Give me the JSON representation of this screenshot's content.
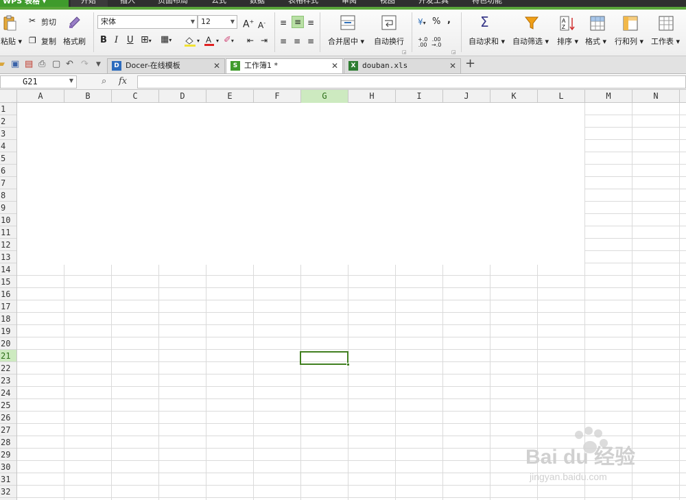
{
  "app": {
    "name": "WPS 表格"
  },
  "menu": [
    "开始",
    "插入",
    "页面布局",
    "公式",
    "数据",
    "表格样式",
    "审阅",
    "视图",
    "开发工具",
    "特色功能"
  ],
  "ribbon": {
    "paste": "粘贴",
    "cut": "剪切",
    "copy": "复制",
    "format_painter": "格式刷",
    "font_name": "宋体",
    "font_size": "12",
    "bold": "B",
    "italic": "I",
    "underline": "U",
    "merge_center": "合并居中",
    "wrap_text": "自动换行",
    "percent": "%",
    "comma": ",",
    "autosum": "自动求和",
    "autofilter": "自动筛选",
    "sort": "排序",
    "format": "格式",
    "rows_cols": "行和列",
    "worksheet": "工作表"
  },
  "tabs": [
    {
      "label": "Docer-在线模板",
      "icon": "D"
    },
    {
      "label": "工作簿1 *",
      "icon": "S"
    },
    {
      "label": "douban.xls",
      "icon": "X"
    }
  ],
  "formula_bar": {
    "name_box": "G21",
    "fx": "fx",
    "value": ""
  },
  "columns": [
    "A",
    "B",
    "C",
    "D",
    "E",
    "F",
    "G",
    "H",
    "I",
    "J",
    "K",
    "L",
    "M",
    "N"
  ],
  "rows": [
    "1",
    "2",
    "3",
    "4",
    "5",
    "6",
    "7",
    "8",
    "9",
    "10",
    "11",
    "12",
    "13",
    "14",
    "15",
    "16",
    "17",
    "18",
    "19",
    "20",
    "21",
    "22",
    "23",
    "24",
    "25",
    "26",
    "27",
    "28",
    "29",
    "30",
    "31",
    "32"
  ],
  "selected": {
    "col": "G",
    "row": "21"
  },
  "watermark": {
    "brand": "Bai du 经验",
    "url": "jingyan.baidu.com"
  },
  "colors": {
    "accent": "#3f9b2c",
    "selected_header": "#cdeac0",
    "active_cell_border": "#3f7e1e"
  }
}
